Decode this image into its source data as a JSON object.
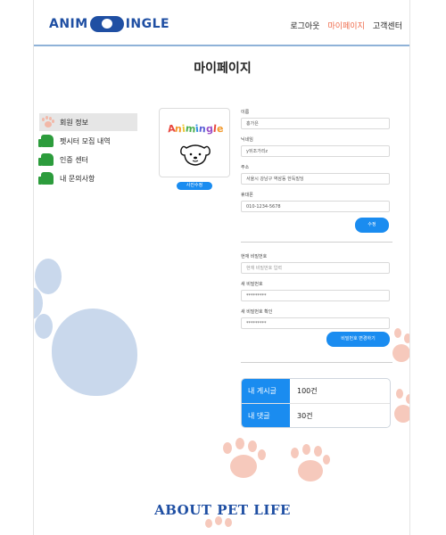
{
  "header": {
    "logo_left": "ANIM",
    "logo_right": "INGLE",
    "nav": [
      {
        "label": "로그아웃"
      },
      {
        "label": "마이페이지",
        "active": true
      },
      {
        "label": "고객센터"
      }
    ]
  },
  "page_title": "마이페이지",
  "sidebar": {
    "items": [
      {
        "label": "회원 정보",
        "icon": "paw-icon",
        "active": true
      },
      {
        "label": "펫시터 모집 내역",
        "icon": "thumbs-up-icon"
      },
      {
        "label": "인증 센터",
        "icon": "thumbs-up-icon"
      },
      {
        "label": "내 문의사항",
        "icon": "thumbs-up-icon"
      }
    ]
  },
  "profile": {
    "logo_text": "Animingle",
    "photo_button": "사진수정"
  },
  "form": {
    "name_label": "이름",
    "name_value": "홍가은",
    "nickname_label": "닉네임",
    "nickname_value": "y뒤조가리z",
    "address_label": "주소",
    "address_value": "서울시 강남구 역삼동 한독빌딩",
    "phone_label": "휴대폰",
    "phone_value": "010-1234-5678",
    "edit_button": "수정"
  },
  "password": {
    "current_label": "현재 비밀번호",
    "current_placeholder": "현재 비밀번호 입력",
    "new_label": "새 비밀번호",
    "new_value": "*********",
    "confirm_label": "새 비밀번호 확인",
    "confirm_value": "*********",
    "change_button": "비밀번호 변경하기"
  },
  "stats": {
    "posts_label": "내 게시글",
    "posts_value": "100건",
    "comments_label": "내 댓글",
    "comments_value": "30건"
  },
  "footer": {
    "text": "ABOUT PET LIFE"
  },
  "colors": {
    "accent": "#1a8cf0",
    "brand": "#1f4fa3",
    "active_nav": "#ef6a4a",
    "paw_blue": "#c9d8ec",
    "paw_pink": "#f6c9bc"
  }
}
